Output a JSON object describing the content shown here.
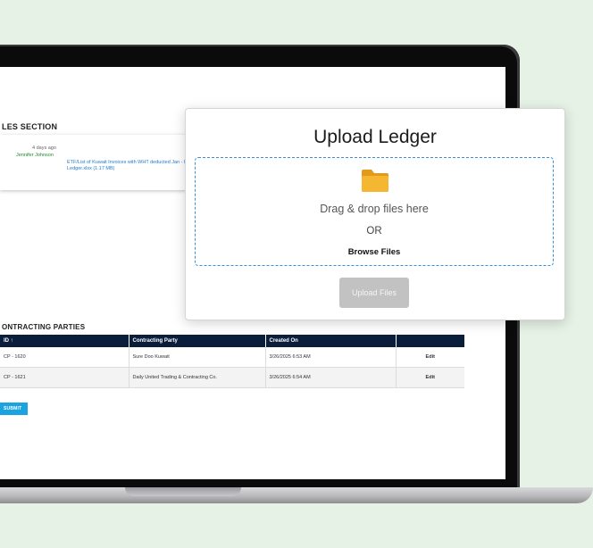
{
  "files_section": {
    "title": "LES SECTION",
    "time_ago": "4 days ago",
    "uploaded_by": "Jennifer Johnson",
    "file_description": "ETF/List of Kuwait Invoices with WHT deducted Jan - Dec 20",
    "file_name": "Ledger.xlsx (1.17 MB)"
  },
  "contracting_parties": {
    "title": "ONTRACTING PARTIES",
    "columns": [
      "ID ↑",
      "Contracting Party",
      "Created On",
      ""
    ],
    "rows": [
      {
        "id": "CP - 1620",
        "party": "Sure Doo Kuwait",
        "created": "3/26/2025 6:53 AM",
        "action": "Edit"
      },
      {
        "id": "CP - 1621",
        "party": "Daily United Trading & Contracting Co.",
        "created": "3/26/2025 6:54 AM",
        "action": "Edit"
      }
    ],
    "submit_label": "SUBMIT"
  },
  "upload_modal": {
    "title": "Upload Ledger",
    "drop_text": "Drag & drop files here",
    "or_text": "OR",
    "browse_label": "Browse Files",
    "upload_button_label": "Upload Files",
    "folder_icon": "folder-icon",
    "accent_color": "#3a8fd6",
    "folder_color": "#f5b731"
  }
}
